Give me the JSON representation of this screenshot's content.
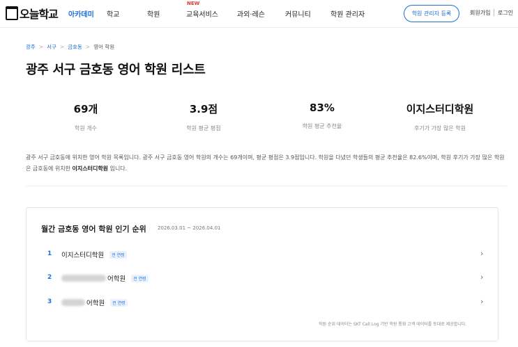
{
  "header": {
    "logo_text": "오늘학교",
    "academy_label": "아카데미",
    "nav": [
      "학교",
      "학원",
      "교육서비스",
      "과외·레슨",
      "커뮤니티",
      "학원 관리자"
    ],
    "new_badge": "NEW",
    "register_label": "학원 관리자 등록",
    "join_label": "회원가입",
    "login_label": "로그인"
  },
  "breadcrumb": [
    "광주",
    "서구",
    "금호동",
    "영어 학원"
  ],
  "page_title": "광주 서구 금호동 영어 학원 리스트",
  "stats": [
    {
      "value": "69개",
      "label": "학원 개수"
    },
    {
      "value": "3.9점",
      "label": "학원 평균 평점"
    },
    {
      "value": "83%",
      "label": "학원 평균 추천율"
    },
    {
      "value": "이지스터디학원",
      "label": "후기가 가장 많은 학원"
    }
  ],
  "description": {
    "part1": "광주 서구 금호동에 위치한 영어 학원 목록입니다. 광주 서구 금호동 영어 학원의 개수는 69개이며, 평균 평점은 3.9점입니다. 학원을 다녔던 학생들의 평균 추천율은 82.6%이며, 학원 후기가 가장 많은 학원은 금호동에 위치한 ",
    "highlight": "이지스터디학원",
    "part2": " 입니다."
  },
  "ranking": {
    "title": "월간 금호동 영어 학원 인기 순위",
    "period": "2026.03.01 ~ 2026.04.01",
    "items": [
      {
        "rank": "1",
        "name": "이지스터디학원",
        "badge": "전 연령"
      },
      {
        "rank": "2",
        "name": "어학원",
        "badge": "전 연령"
      },
      {
        "rank": "3",
        "name": "어학원",
        "badge": "전 연령"
      }
    ],
    "note": "학원 순위 데이터는 SKT Call Log 기반 학원 통화 고객 데이터를 토대로 제공합니다."
  }
}
